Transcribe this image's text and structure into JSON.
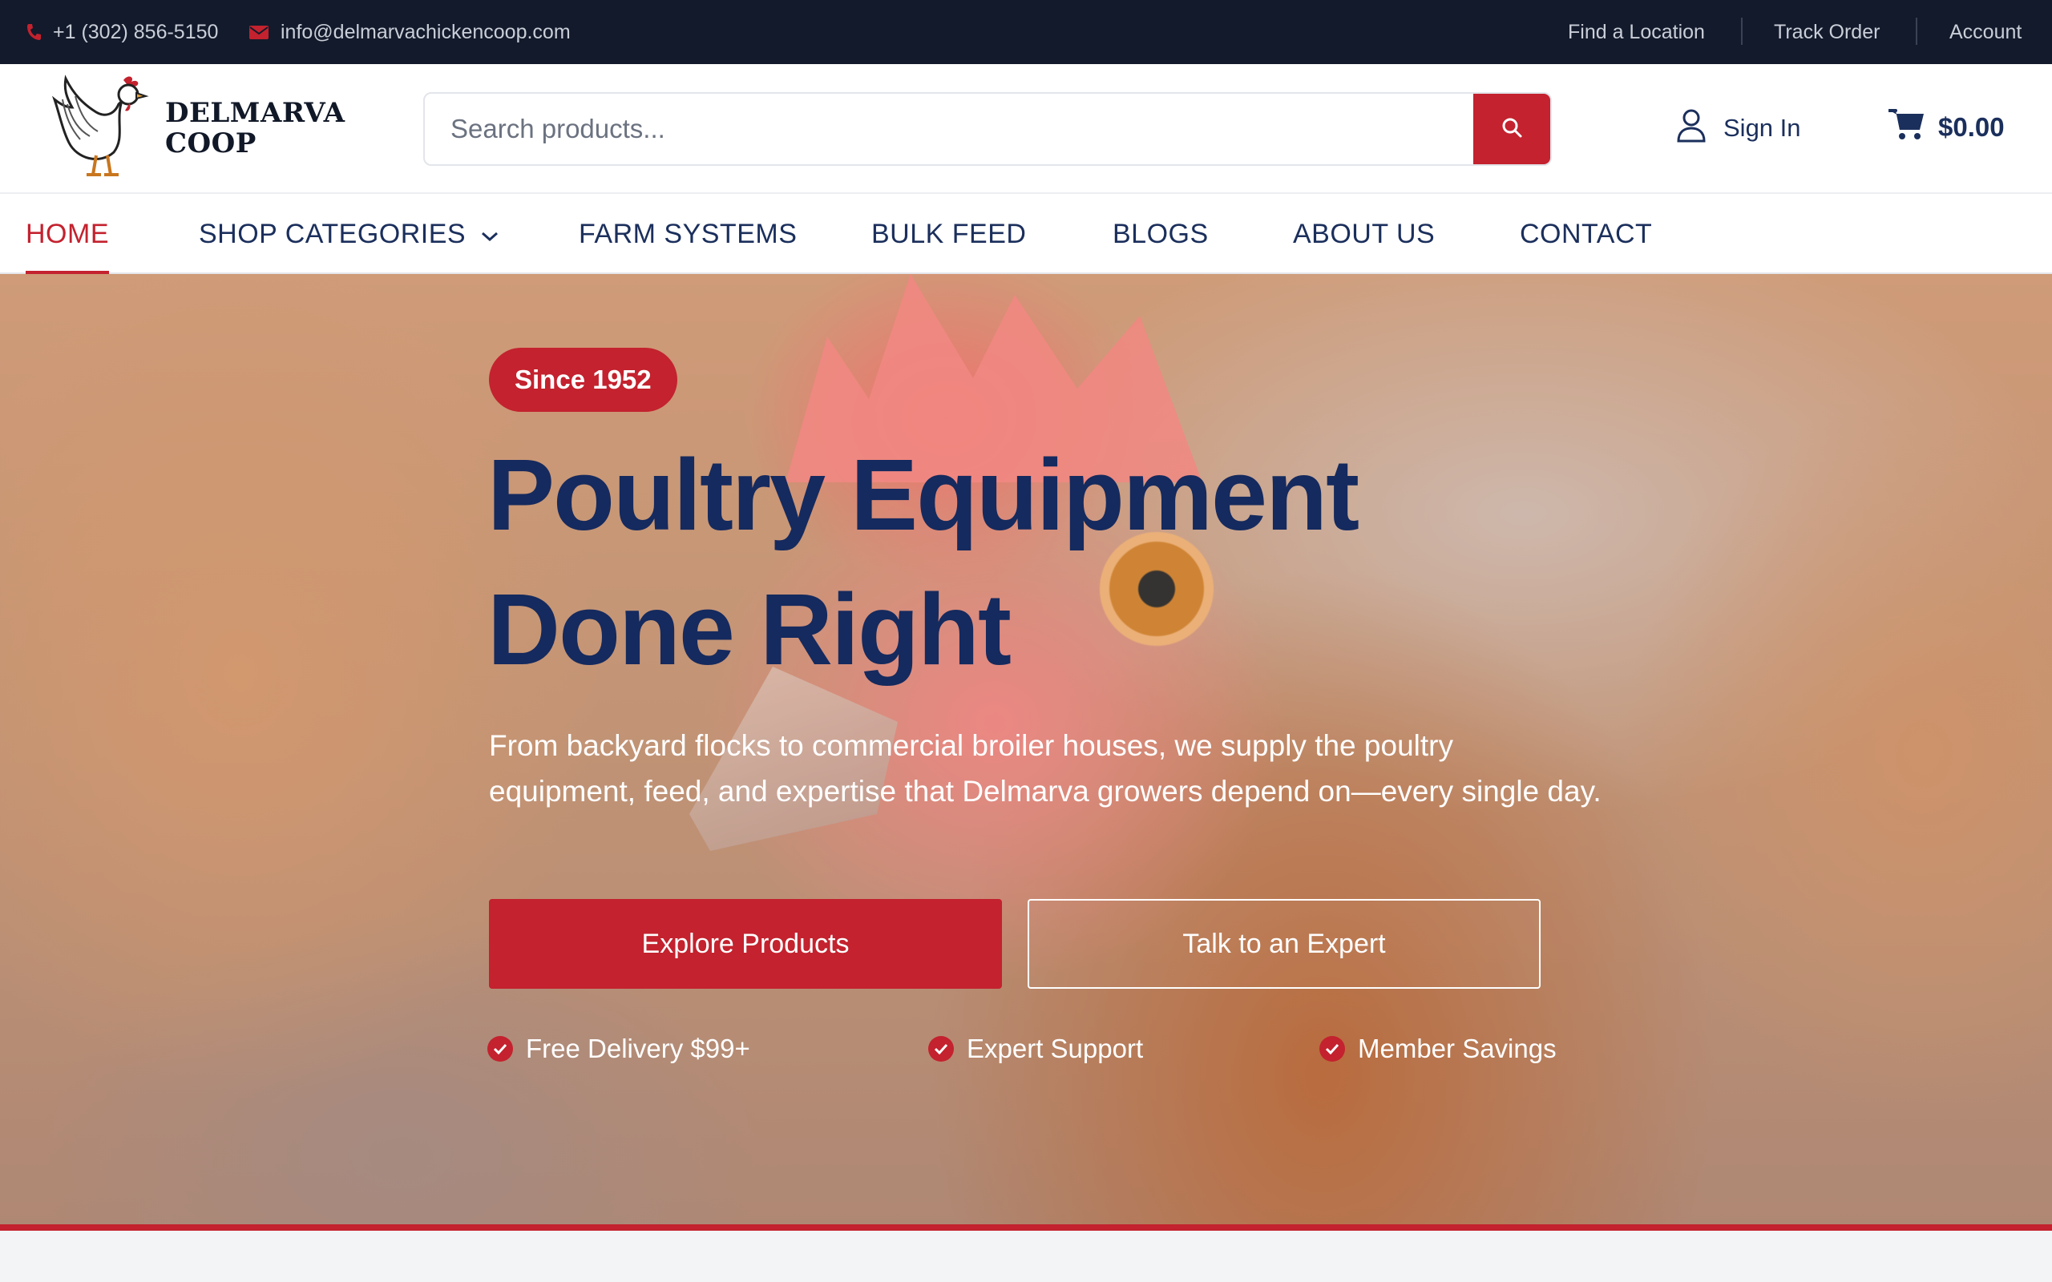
{
  "topbar": {
    "phone": "+1 (302) 856-5150",
    "email": "info@delmarvachickencoop.com",
    "links": [
      "Find a Location",
      "Track Order",
      "Account"
    ]
  },
  "header": {
    "logo_line1": "DELMARVA",
    "logo_line2": "COOP",
    "search_placeholder": "Search products...",
    "sign_in": "Sign In",
    "cart_total": "$0.00"
  },
  "nav": {
    "items": [
      "HOME",
      "SHOP CATEGORIES",
      "FARM SYSTEMS",
      "BULK FEED",
      "BLOGS",
      "ABOUT US",
      "CONTACT"
    ],
    "active": "HOME"
  },
  "hero": {
    "badge": "Since 1952",
    "headline_line1": "Poultry Equipment",
    "headline_line2": "Done Right",
    "subcopy": "From backyard flocks to commercial broiler houses, we supply the poultry equipment, feed, and expertise that Delmarva growers depend on—every single day.",
    "primary_cta": "Explore Products",
    "secondary_cta": "Talk to an Expert",
    "features": [
      "Free Delivery $99+",
      "Expert Support",
      "Member Savings"
    ]
  },
  "colors": {
    "topbar_bg": "#131a2b",
    "brand_red": "#c3222e",
    "navy": "#152a5e"
  }
}
